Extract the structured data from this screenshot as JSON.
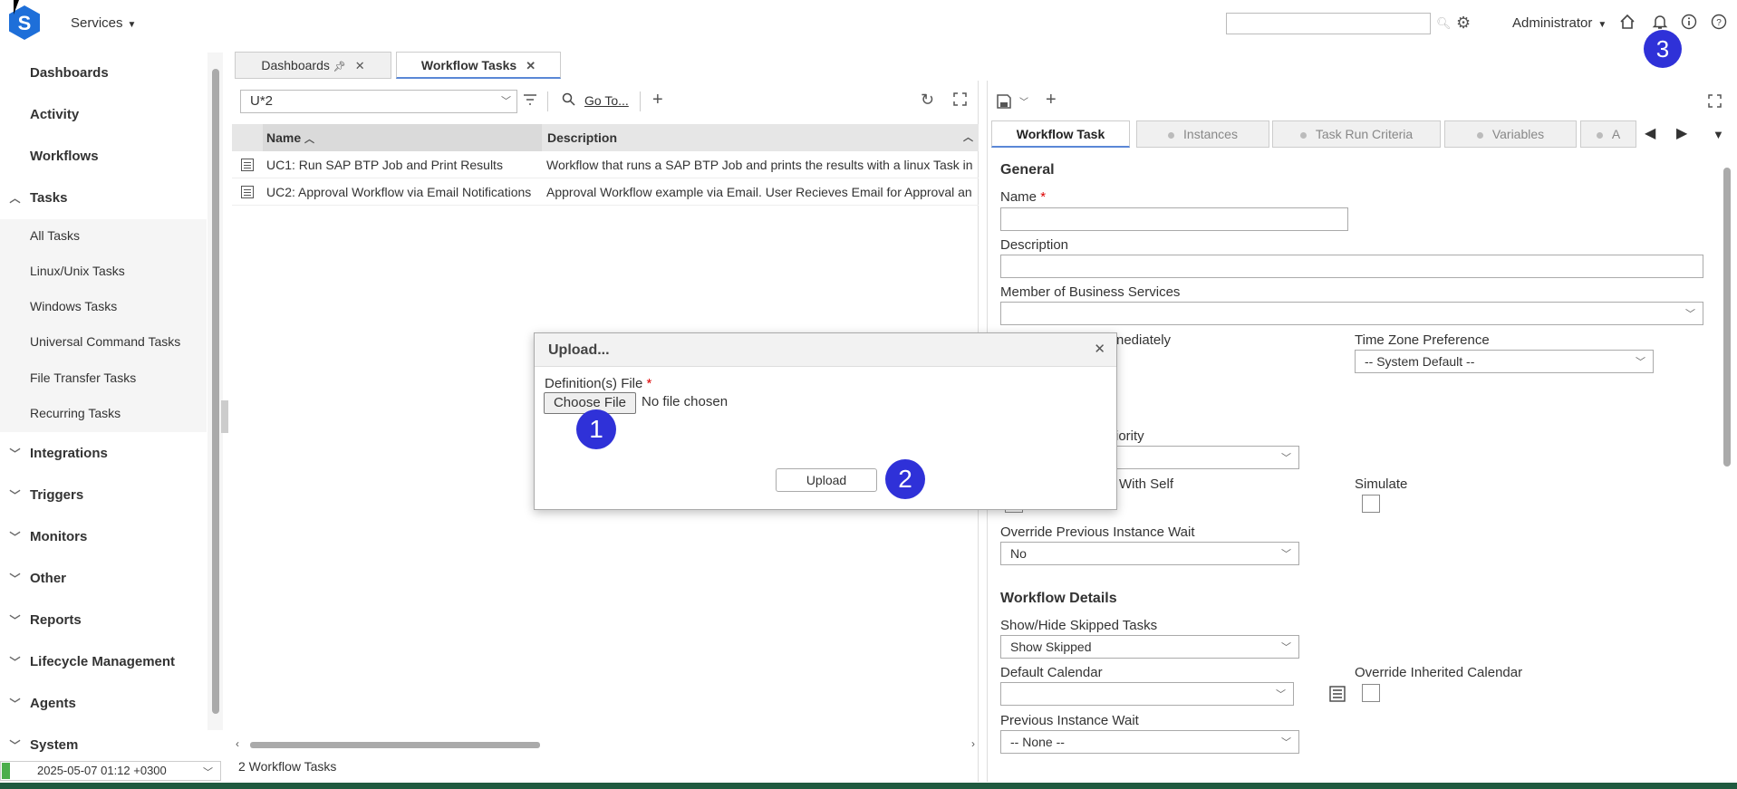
{
  "topbar": {
    "services_label": "Services",
    "admin_label": "Administrator",
    "notification_count": "3"
  },
  "sidebar": {
    "top_items": [
      "Dashboards",
      "Activity",
      "Workflows"
    ],
    "tasks_label": "Tasks",
    "task_items": [
      "All Tasks",
      "Linux/Unix Tasks",
      "Windows Tasks",
      "Universal Command Tasks",
      "File Transfer Tasks",
      "Recurring Tasks"
    ],
    "groups": [
      "Integrations",
      "Triggers",
      "Monitors",
      "Other",
      "Reports",
      "Lifecycle Management",
      "Agents",
      "System"
    ],
    "datetime": "2025-05-07 01:12 +0300"
  },
  "tabs": [
    {
      "label": "Dashboards"
    },
    {
      "label": "Workflow Tasks"
    }
  ],
  "list": {
    "filter_value": "U*2",
    "goto_label": "Go To...",
    "columns": {
      "name": "Name",
      "description": "Description"
    },
    "rows": [
      {
        "name": "UC1: Run SAP BTP Job and Print Results",
        "description": "Workflow that runs a SAP BTP Job and prints the results with a linux Task in"
      },
      {
        "name": "UC2: Approval Workflow via Email Notifications",
        "description": "Approval Workflow example via Email. User Recieves Email for Approval an"
      }
    ],
    "count_label": "2 Workflow Tasks"
  },
  "detail": {
    "tabs": [
      "Workflow Task",
      "Instances",
      "Task Run Criteria",
      "Variables",
      "A"
    ],
    "general_title": "General",
    "name_label": "Name",
    "description_label": "Description",
    "member_label": "Member of Business Services",
    "hold_label": "nediately",
    "tz_label": "Time Zone Preference",
    "tz_value": "-- System Default --",
    "priority_label": "riority",
    "with_self_label": "With Self",
    "simulate_label": "Simulate",
    "override_label": "Override Previous Instance Wait",
    "override_value": "No",
    "workflow_details_title": "Workflow Details",
    "skipped_label": "Show/Hide Skipped Tasks",
    "skipped_value": "Show Skipped",
    "calendar_label": "Default Calendar",
    "override_cal_label": "Override Inherited Calendar",
    "prev_wait_label": "Previous Instance Wait",
    "prev_wait_value": "-- None --"
  },
  "modal": {
    "title": "Upload...",
    "file_label": "Definition(s) File",
    "choose_file": "Choose File",
    "no_file": "No file chosen",
    "upload_label": "Upload",
    "badge1": "1",
    "badge2": "2"
  }
}
